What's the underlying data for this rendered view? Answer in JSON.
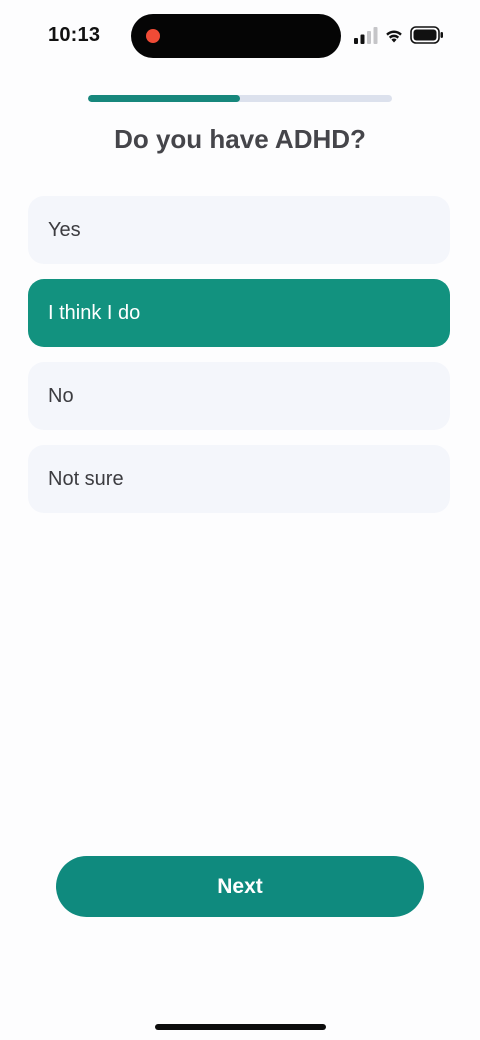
{
  "status_bar": {
    "time": "10:13",
    "icons": [
      "signal-icon",
      "wifi-icon",
      "battery-icon"
    ],
    "recording_color": "#ef4b36"
  },
  "progress": {
    "fraction": 0.5,
    "fill_color": "#17877c",
    "track_color": "#dce1ed"
  },
  "question": {
    "title": "Do you have ADHD?"
  },
  "options": [
    {
      "label": "Yes",
      "selected": false
    },
    {
      "label": "I think I do",
      "selected": true
    },
    {
      "label": "No",
      "selected": false
    },
    {
      "label": "Not sure",
      "selected": false
    }
  ],
  "colors": {
    "accent": "#12927f",
    "option_bg": "#f4f6fb",
    "button": "#0f8a7e"
  },
  "footer": {
    "next_label": "Next"
  }
}
